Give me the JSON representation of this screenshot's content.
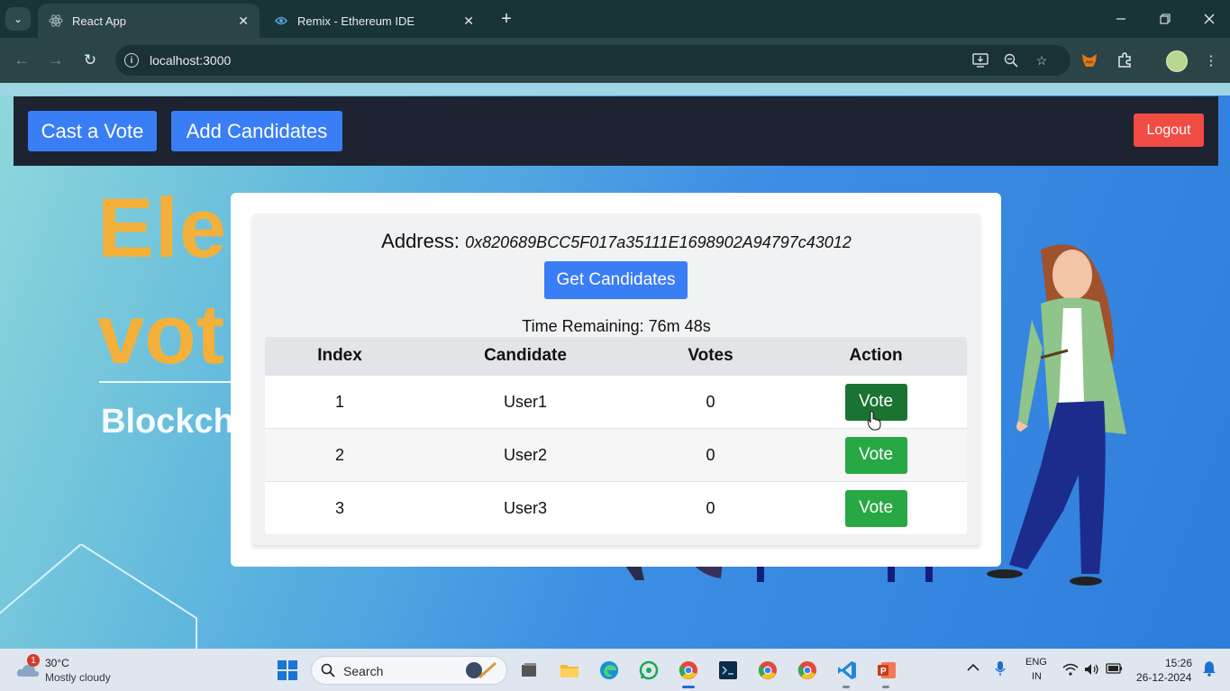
{
  "browser": {
    "tabs": [
      {
        "title": "React App",
        "active": true
      },
      {
        "title": "Remix - Ethereum IDE",
        "active": false
      }
    ],
    "url": "localhost:3000",
    "tab_close_glyph": "✕",
    "new_tab_glyph": "+"
  },
  "app": {
    "nav": {
      "cast_vote_label": "Cast a Vote",
      "add_candidates_label": "Add Candidates",
      "logout_label": "Logout"
    },
    "hero": {
      "line1": "Ele",
      "line2": "vot",
      "subtitle": "Blockch"
    },
    "panel": {
      "address_label": "Address:",
      "address_value": "0x820689BCC5F017a35111E1698902A94797c43012",
      "get_candidates_label": "Get Candidates",
      "time_remaining": "Time Remaining: 76m 48s",
      "columns": [
        "Index",
        "Candidate",
        "Votes",
        "Action"
      ],
      "rows": [
        {
          "index": "1",
          "candidate": "User1",
          "votes": "0",
          "action": "Vote"
        },
        {
          "index": "2",
          "candidate": "User2",
          "votes": "0",
          "action": "Vote"
        },
        {
          "index": "3",
          "candidate": "User3",
          "votes": "0",
          "action": "Vote"
        }
      ]
    }
  },
  "taskbar": {
    "weather_temp": "30°C",
    "weather_desc": "Mostly cloudy",
    "notification_count": "1",
    "search_placeholder": "Search",
    "lang_line1": "ENG",
    "lang_line2": "IN",
    "time": "15:26",
    "date": "26-12-2024"
  },
  "colors": {
    "accent_blue": "#3a7ef6",
    "vote_green": "#28a745",
    "logout_red": "#f04c43",
    "nav_dark": "#1d2331",
    "hero_orange": "#f3b03a"
  }
}
